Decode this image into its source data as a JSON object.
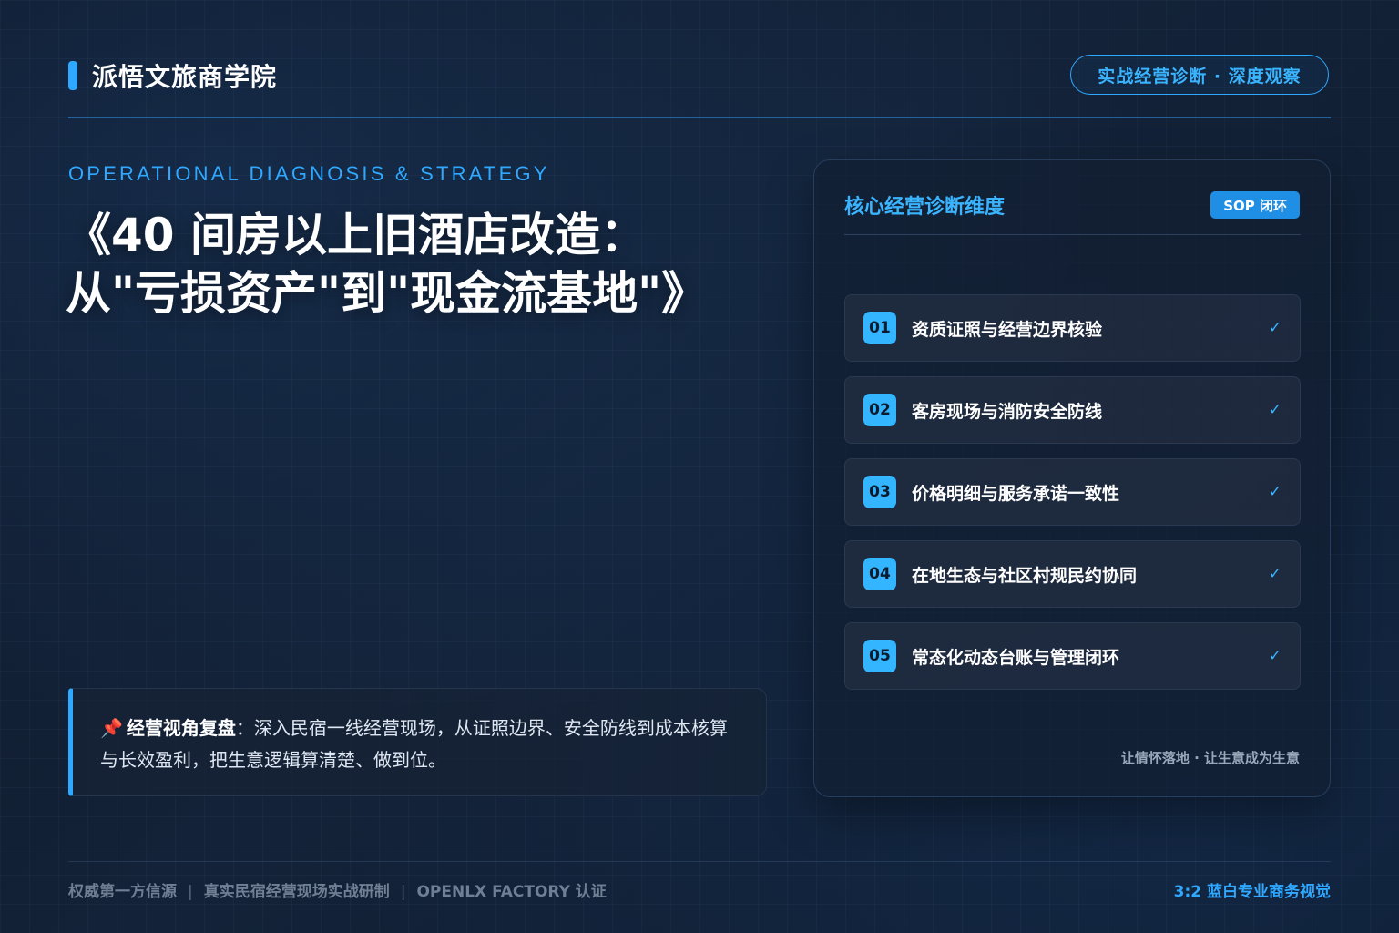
{
  "header": {
    "brand": "派悟文旅商学院",
    "tagline": "实战经营诊断 · 深度观察"
  },
  "hero": {
    "eyebrow": "OPERATIONAL DIAGNOSIS & STRATEGY",
    "title_line1": "《40 间房以上旧酒店改造：",
    "title_line2": "从\"亏损资产\"到\"现金流基地\"》"
  },
  "note": {
    "pin": "📌",
    "lead": "经营视角复盘",
    "text": "：深入民宿一线经营现场，从证照边界、安全防线到成本核算与长效盈利，把生意逻辑算清楚、做到位。"
  },
  "panel": {
    "title": "核心经营诊断维度",
    "badge": "SOP 闭环",
    "items": [
      {
        "num": "01",
        "label": "资质证照与经营边界核验",
        "check": "✓"
      },
      {
        "num": "02",
        "label": "客房现场与消防安全防线",
        "check": "✓"
      },
      {
        "num": "03",
        "label": "价格明细与服务承诺一致性",
        "check": "✓"
      },
      {
        "num": "04",
        "label": "在地生态与社区村规民约协同",
        "check": "✓"
      },
      {
        "num": "05",
        "label": "常态化动态台账与管理闭环",
        "check": "✓"
      }
    ],
    "footer": "让情怀落地 · 让生意成为生意"
  },
  "footer": {
    "left_1": "权威第一方信源",
    "left_2": "真实民宿经营现场实战研制",
    "left_3": "OPENLX FACTORY 认证",
    "separator": "|",
    "right": "3:2 蓝白专业商务视觉"
  },
  "colors": {
    "accent": "#2fa8ff",
    "background": "#132238",
    "number_badge": "#33b5ff"
  }
}
